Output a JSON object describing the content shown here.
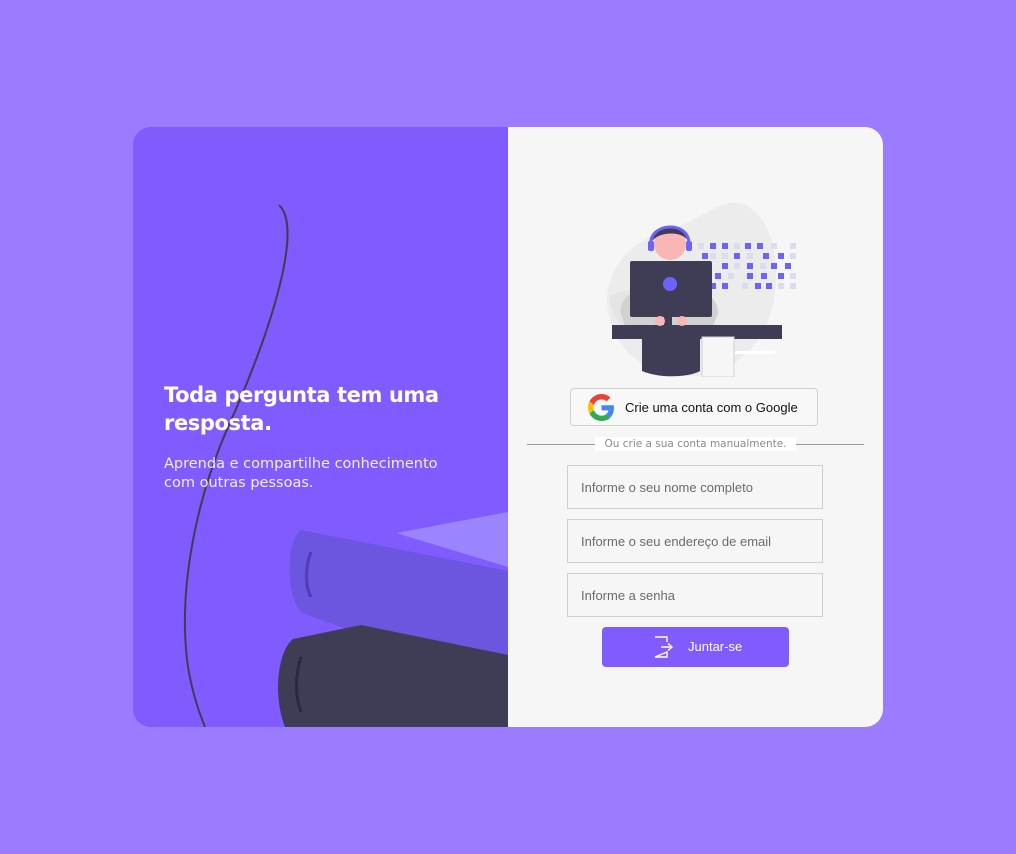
{
  "hero": {
    "title": "Toda pergunta tem uma resposta.",
    "subtitle": "Aprenda e compartilhe conhecimento com outras pessoas."
  },
  "signup": {
    "google_button_label": "Crie uma conta com o Google",
    "divider_text": "Ou crie a sua conta manualmente.",
    "name_placeholder": "Informe o seu nome completo",
    "email_placeholder": "Informe o seu endereço de email",
    "password_placeholder": "Informe a senha",
    "submit_label": "Juntar-se"
  },
  "icons": {
    "google": "google-icon",
    "join": "log-in-icon",
    "illustration": "person-at-computer-illustration"
  },
  "colors": {
    "page_background": "#9b7cfe",
    "accent": "#805bfd",
    "panel_background": "#f6f6f6",
    "dark_ink": "#3f3d56"
  }
}
